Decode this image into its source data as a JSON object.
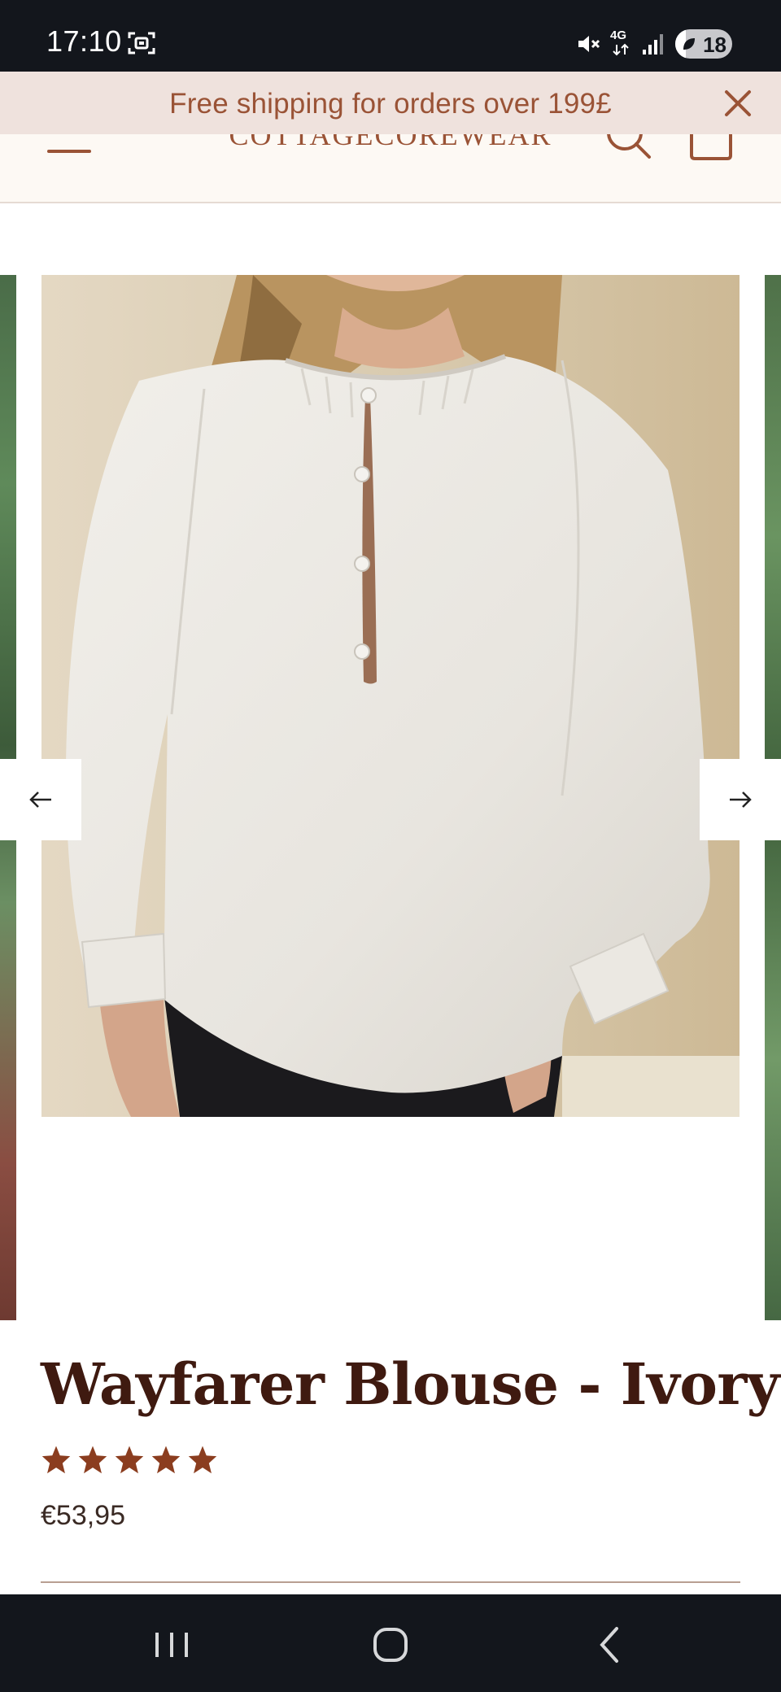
{
  "status_bar": {
    "time": "17:10",
    "network": "4G",
    "battery_level": "18"
  },
  "announcement": {
    "text": "Free shipping for orders over 199£"
  },
  "header": {
    "logo": "COTTAGECOREWEAR"
  },
  "product": {
    "title": "Wayfarer Blouse - Ivory",
    "rating": 5,
    "rating_max": 5,
    "price": "€53,95"
  },
  "colors": {
    "accent": "#9a5336",
    "announcement_bg": "#efe2dd",
    "title": "#3f1a10",
    "star": "#8b3d1f",
    "system_bar": "#13161c"
  },
  "icons": {
    "status": [
      "screen-recorder-icon",
      "mute-icon",
      "network-4g-icon",
      "signal-icon",
      "battery-saver-icon"
    ],
    "header": [
      "menu-icon",
      "search-icon",
      "cart-icon"
    ],
    "carousel": [
      "arrow-left-icon",
      "arrow-right-icon"
    ],
    "nav": [
      "recent-apps-icon",
      "home-icon",
      "back-icon"
    ]
  }
}
